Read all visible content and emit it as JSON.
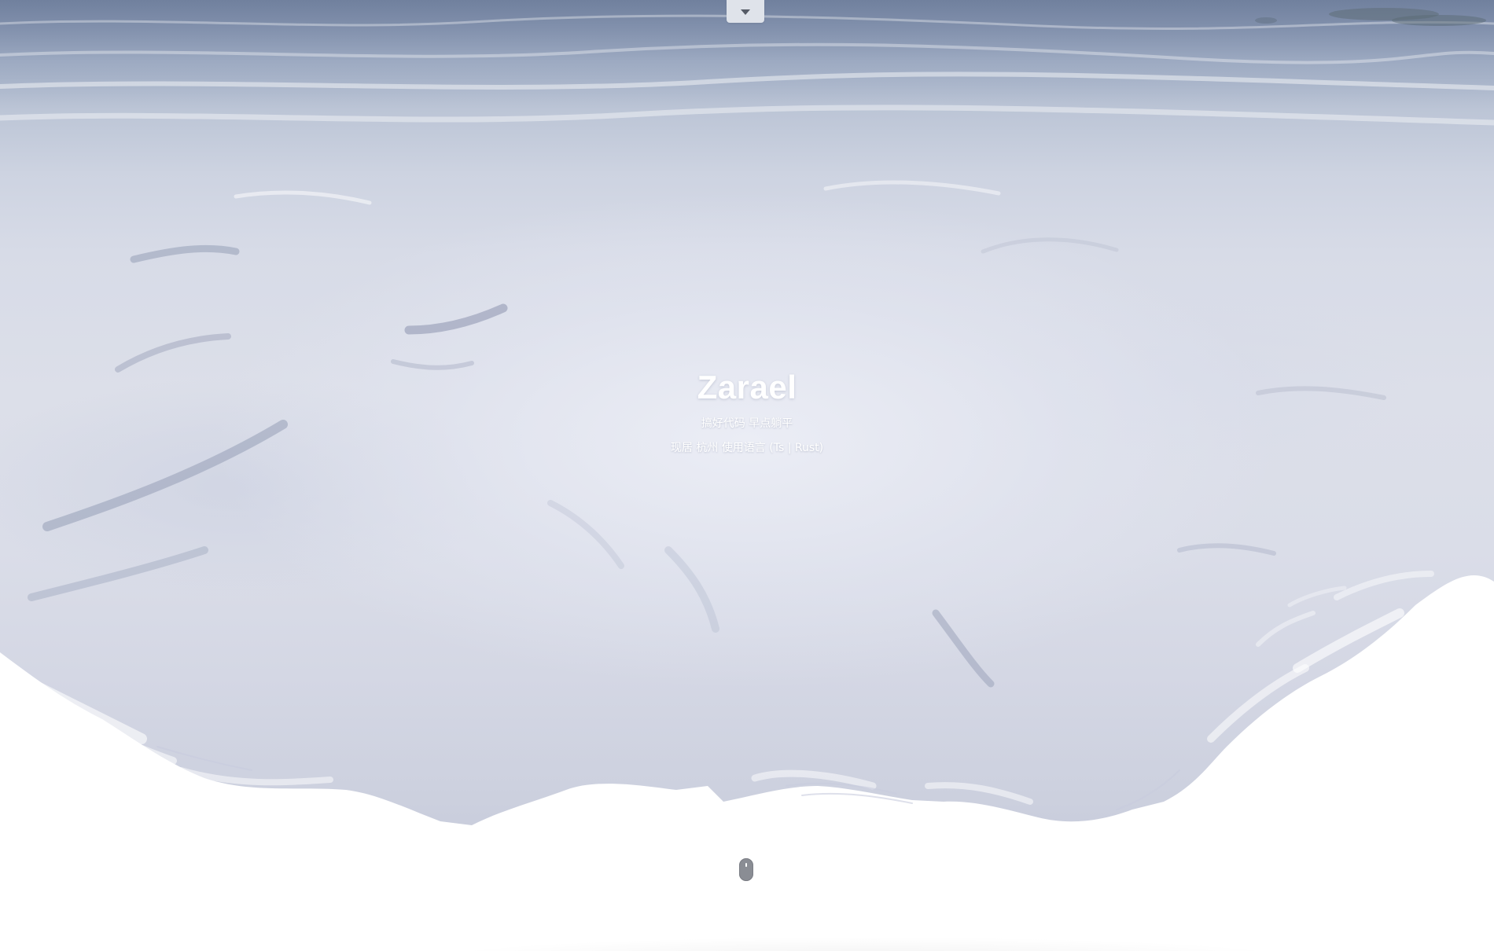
{
  "hero": {
    "title": "Zarael",
    "tagline": "搞好代码 早点躺平",
    "info": "现居 杭州 使用语言 (Ts | Rust)"
  },
  "controls": {
    "top_toggle_icon": "caret-down-icon",
    "scroll_hint_icon": "mouse-icon"
  },
  "colors": {
    "hero_text": "#ffffff",
    "page_background": "#ffffff",
    "toggle_background": "#dfe3ea",
    "mouse_color": "#8a8d94"
  }
}
